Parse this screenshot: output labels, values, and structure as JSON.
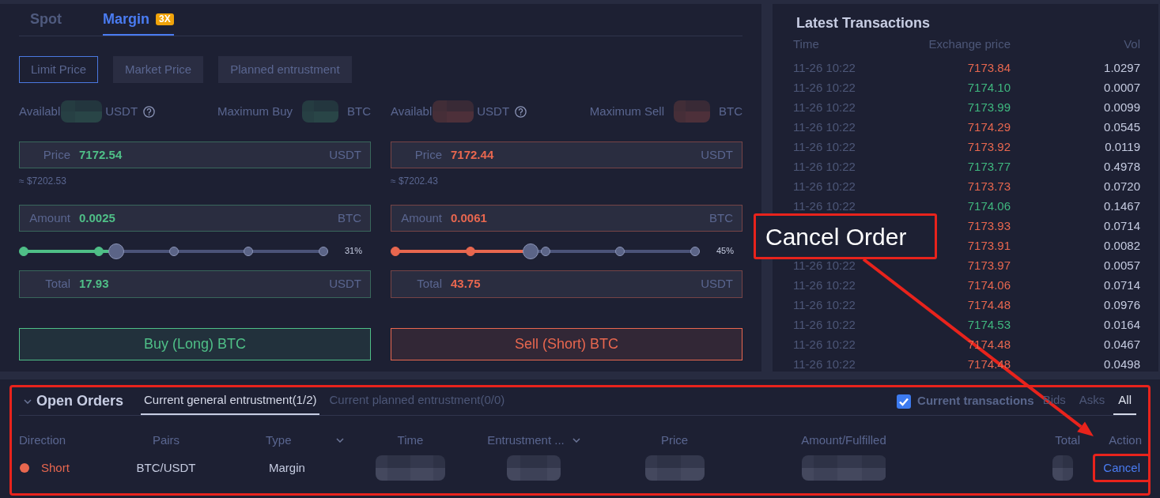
{
  "trade_tabs": [
    {
      "label": "Spot",
      "selected": false
    },
    {
      "label": "Margin",
      "selected": true,
      "badge": "3X"
    }
  ],
  "order_types": [
    {
      "label": "Limit Price",
      "selected": true
    },
    {
      "label": "Market Price",
      "selected": false
    },
    {
      "label": "Planned entrustment",
      "selected": false
    }
  ],
  "forms": [
    {
      "color": "#4fbf87",
      "available": {
        "label": "Availabl",
        "value": {
          "kind": "redacted"
        },
        "unit": "USDT"
      },
      "maximum": {
        "label": "Maximum Buy",
        "value": {
          "kind": "redacted"
        },
        "unit": "BTC"
      },
      "price": {
        "label": "Price",
        "value": "7172.54",
        "unit": "USDT"
      },
      "estimate": "≈ $7202.53",
      "amount": {
        "label": "Amount",
        "value": "0.0025",
        "unit": "BTC"
      },
      "slider": {
        "level": 0.31,
        "reading": "31%"
      },
      "total": {
        "label": "Total",
        "value": "17.93",
        "unit": "USDT"
      },
      "submit": "Buy (Long) BTC"
    },
    {
      "color": "#e8674f",
      "available": {
        "label": "Availabl",
        "value": {
          "kind": "redacted"
        },
        "unit": "USDT"
      },
      "maximum": {
        "label": "Maximum Sell",
        "value": {
          "kind": "redacted"
        },
        "unit": "BTC"
      },
      "price": {
        "label": "Price",
        "value": "7172.44",
        "unit": "USDT"
      },
      "estimate": "≈ $7202.43",
      "amount": {
        "label": "Amount",
        "value": "0.0061",
        "unit": "BTC"
      },
      "slider": {
        "level": 0.45,
        "reading": "45%"
      },
      "total": {
        "label": "Total",
        "value": "43.75",
        "unit": "USDT"
      },
      "submit": "Sell (Short) BTC"
    }
  ],
  "latest_transactions": {
    "title": "Latest Transactions",
    "columns": [
      "Time",
      "Exchange price",
      "Vol"
    ],
    "rows": [
      {
        "time": "11-26 10:22",
        "price": "7173.84",
        "color": "#e8674f",
        "vol": "1.0297"
      },
      {
        "time": "11-26 10:22",
        "price": "7174.10",
        "color": "#3fb87f",
        "vol": "0.0007"
      },
      {
        "time": "11-26 10:22",
        "price": "7173.99",
        "color": "#3fb87f",
        "vol": "0.0099"
      },
      {
        "time": "11-26 10:22",
        "price": "7174.29",
        "color": "#e8674f",
        "vol": "0.0545"
      },
      {
        "time": "11-26 10:22",
        "price": "7173.92",
        "color": "#e8674f",
        "vol": "0.0119"
      },
      {
        "time": "11-26 10:22",
        "price": "7173.77",
        "color": "#3fb87f",
        "vol": "0.4978"
      },
      {
        "time": "11-26 10:22",
        "price": "7173.73",
        "color": "#e8674f",
        "vol": "0.0720"
      },
      {
        "time": "11-26 10:22",
        "price": "7174.06",
        "color": "#3fb87f",
        "vol": "0.1467"
      },
      {
        "price": "7173.93",
        "color": "#e8674f",
        "vol": "0.0714"
      },
      {
        "price": "7173.91",
        "color": "#e8674f",
        "vol": "0.0082"
      },
      {
        "time": "11-26 10:22",
        "price": "7173.97",
        "color": "#e8674f",
        "vol": "0.0057"
      },
      {
        "time": "11-26 10:22",
        "price": "7174.06",
        "color": "#e8674f",
        "vol": "0.0714"
      },
      {
        "time": "11-26 10:22",
        "price": "7174.48",
        "color": "#e8674f",
        "vol": "0.0976"
      },
      {
        "time": "11-26 10:22",
        "price": "7174.53",
        "color": "#3fb87f",
        "vol": "0.0164"
      },
      {
        "time": "11-26 10:22",
        "price": "7174.48",
        "color": "#e8674f",
        "vol": "0.0467"
      },
      {
        "time": "11-26 10:22",
        "price": "7174.48",
        "color": "#e8674f",
        "vol": "0.0498"
      }
    ]
  },
  "open_orders": {
    "title": "Open Orders",
    "expanded": true,
    "highlighted": true,
    "tabs": [
      {
        "label": "Current general entrustment(1/2)",
        "selected": true
      },
      {
        "label": "Current planned entrustment(0/0)",
        "selected": false
      }
    ],
    "filter": {
      "checkbox": {
        "label": "Current transactions",
        "checked": true
      },
      "sides": [
        {
          "label": "Bids",
          "selected": false
        },
        {
          "label": "Asks",
          "selected": false
        },
        {
          "label": "All",
          "selected": true
        }
      ]
    },
    "columns": [
      {
        "label": "Direction"
      },
      {
        "label": "Pairs"
      },
      {
        "label": "Type",
        "dropdown": true
      },
      {
        "label": "Time"
      },
      {
        "label": "Entrustment ...",
        "dropdown": true
      },
      {
        "label": "Price"
      },
      {
        "label": "Amount/Fulfilled"
      },
      {
        "label": "Total"
      },
      {
        "label": "Action"
      }
    ],
    "rows": [
      {
        "cells": [
          {
            "kind": "direction",
            "text": "Short",
            "color": "#e8674f"
          },
          {
            "kind": "text",
            "text": "BTC/USDT"
          },
          {
            "kind": "text",
            "text": "Margin"
          },
          {
            "kind": "redacted"
          },
          {
            "kind": "redacted"
          },
          {
            "kind": "redacted"
          },
          {
            "kind": "redacted"
          },
          {
            "kind": "redacted"
          },
          {
            "kind": "action",
            "text": "Cancel",
            "highlighted": true
          }
        ]
      }
    ]
  },
  "callout": {
    "text": "Cancel Order"
  }
}
